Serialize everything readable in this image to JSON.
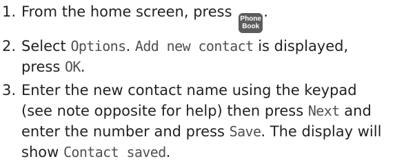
{
  "steps": [
    {
      "number": "1.",
      "parts": [
        {
          "t": "text",
          "v": "From the home screen, press "
        },
        {
          "t": "key",
          "lines": [
            "Phone",
            "Book"
          ]
        },
        {
          "t": "text",
          "v": "."
        }
      ]
    },
    {
      "number": "2.",
      "parts": [
        {
          "t": "text",
          "v": "Select "
        },
        {
          "t": "lcd",
          "v": "Options"
        },
        {
          "t": "text",
          "v": ". "
        },
        {
          "t": "lcd",
          "v": "Add new contact"
        },
        {
          "t": "text",
          "v": " is displayed, press "
        },
        {
          "t": "lcd",
          "v": "OK"
        },
        {
          "t": "text",
          "v": "."
        }
      ]
    },
    {
      "number": "3.",
      "parts": [
        {
          "t": "text",
          "v": "Enter the new contact name using the keypad (see note opposite for help) then press "
        },
        {
          "t": "lcd",
          "v": "Next"
        },
        {
          "t": "text",
          "v": " and enter the number and press "
        },
        {
          "t": "lcd",
          "v": "Save"
        },
        {
          "t": "text",
          "v": ". The display will show "
        },
        {
          "t": "lcd",
          "v": "Contact saved"
        },
        {
          "t": "text",
          "v": "."
        }
      ]
    }
  ],
  "colors": {
    "text": "#231f20",
    "lcd_text": "#505050",
    "key_background": "#5c5c5c",
    "key_text": "#ffffff"
  }
}
